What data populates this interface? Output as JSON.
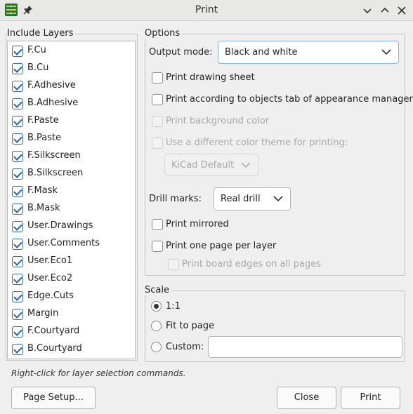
{
  "window": {
    "title": "Print"
  },
  "icons": {
    "app": "kicad-pcb-icon",
    "pin": "pin-icon",
    "minimize": "chevron-down-icon",
    "maximize": "chevron-up-icon",
    "close": "close-icon"
  },
  "layers": {
    "group_label": "Include Layers",
    "items": [
      {
        "label": "F.Cu",
        "checked": true
      },
      {
        "label": "B.Cu",
        "checked": true
      },
      {
        "label": "F.Adhesive",
        "checked": true
      },
      {
        "label": "B.Adhesive",
        "checked": true
      },
      {
        "label": "F.Paste",
        "checked": true
      },
      {
        "label": "B.Paste",
        "checked": true
      },
      {
        "label": "F.Silkscreen",
        "checked": true
      },
      {
        "label": "B.Silkscreen",
        "checked": true
      },
      {
        "label": "F.Mask",
        "checked": true
      },
      {
        "label": "B.Mask",
        "checked": true
      },
      {
        "label": "User.Drawings",
        "checked": true
      },
      {
        "label": "User.Comments",
        "checked": true
      },
      {
        "label": "User.Eco1",
        "checked": true
      },
      {
        "label": "User.Eco2",
        "checked": true
      },
      {
        "label": "Edge.Cuts",
        "checked": true
      },
      {
        "label": "Margin",
        "checked": true
      },
      {
        "label": "F.Courtyard",
        "checked": true
      },
      {
        "label": "B.Courtyard",
        "checked": true
      }
    ],
    "hint": "Right-click for layer selection commands."
  },
  "options": {
    "group_label": "Options",
    "output_mode_label": "Output mode:",
    "output_mode_value": "Black and white",
    "print_drawing_sheet": "Print drawing sheet",
    "print_by_appearance": "Print according to objects tab of appearance manager",
    "print_background": "Print background color",
    "different_theme": "Use a different color theme for printing:",
    "theme_value": "KiCad Default",
    "drill_marks_label": "Drill marks:",
    "drill_marks_value": "Real drill",
    "print_mirrored": "Print mirrored",
    "one_page_per_layer": "Print one page per layer",
    "board_edges_all_pages": "Print board edges on all pages"
  },
  "scale": {
    "group_label": "Scale",
    "one_to_one": "1:1",
    "fit_to_page": "Fit to page",
    "custom": "Custom:",
    "custom_value": "",
    "selected": "1:1"
  },
  "buttons": {
    "page_setup": "Page Setup...",
    "close": "Close",
    "print": "Print"
  },
  "colors": {
    "accent": "#2c64a5",
    "background": "#efefef"
  }
}
